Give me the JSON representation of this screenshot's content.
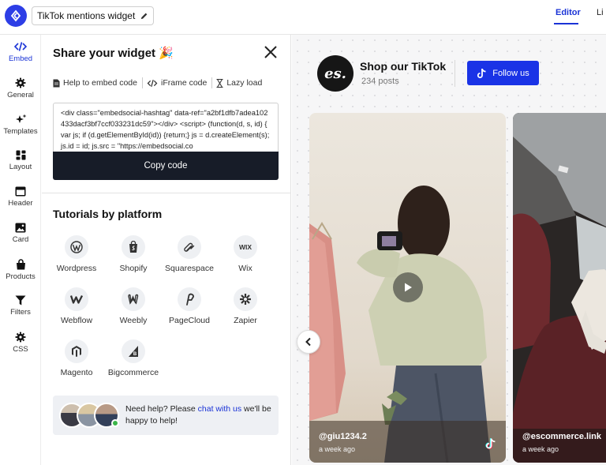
{
  "header": {
    "widget_title": "TikTok mentions widget",
    "tabs": [
      {
        "label": "Editor"
      },
      {
        "label": "Li"
      }
    ]
  },
  "leftnav": {
    "items": [
      {
        "label": "Embed",
        "icon": "code-icon"
      },
      {
        "label": "General",
        "icon": "gear-icon"
      },
      {
        "label": "Templates",
        "icon": "sparkle-icon"
      },
      {
        "label": "Layout",
        "icon": "grid-icon"
      },
      {
        "label": "Header",
        "icon": "header-icon"
      },
      {
        "label": "Card",
        "icon": "image-icon"
      },
      {
        "label": "Products",
        "icon": "bag-icon"
      },
      {
        "label": "Filters",
        "icon": "filter-icon"
      },
      {
        "label": "CSS",
        "icon": "gear-icon"
      }
    ]
  },
  "panel": {
    "title": "Share your widget 🎉",
    "tabs": [
      "Help to embed code",
      "iFrame code",
      "Lazy load"
    ],
    "code": "<div class=\"embedsocial-hashtag\" data-ref=\"a2bf1dfb7adea102433dacf3bf7ccf033231dc59\"></div> <script> (function(d, s, id) { var js; if (d.getElementById(id)) {return;} js = d.createElement(s); js.id = id; js.src = \"https://embedsocial.co",
    "copy_label": "Copy code",
    "tutorials_title": "Tutorials by platform",
    "platforms": [
      "Wordpress",
      "Shopify",
      "Squarespace",
      "Wix",
      "Webflow",
      "Weebly",
      "PageCloud",
      "Zapier",
      "Magento",
      "Bigcommerce"
    ],
    "help": {
      "text_before": "Need help? Please ",
      "link": "chat with us",
      "text_after": " we'll be happy to help!"
    }
  },
  "preview": {
    "shop_title": "Shop our TikTok",
    "posts": "234 posts",
    "follow_label": "Follow us",
    "cards": [
      {
        "user": "@giu1234.2",
        "time": "a week ago"
      },
      {
        "user": "@escommerce.link",
        "time": "a week ago"
      }
    ]
  },
  "colors": {
    "accent": "#1a33e6",
    "dark_button": "#171c28",
    "online": "#3bb54a"
  }
}
